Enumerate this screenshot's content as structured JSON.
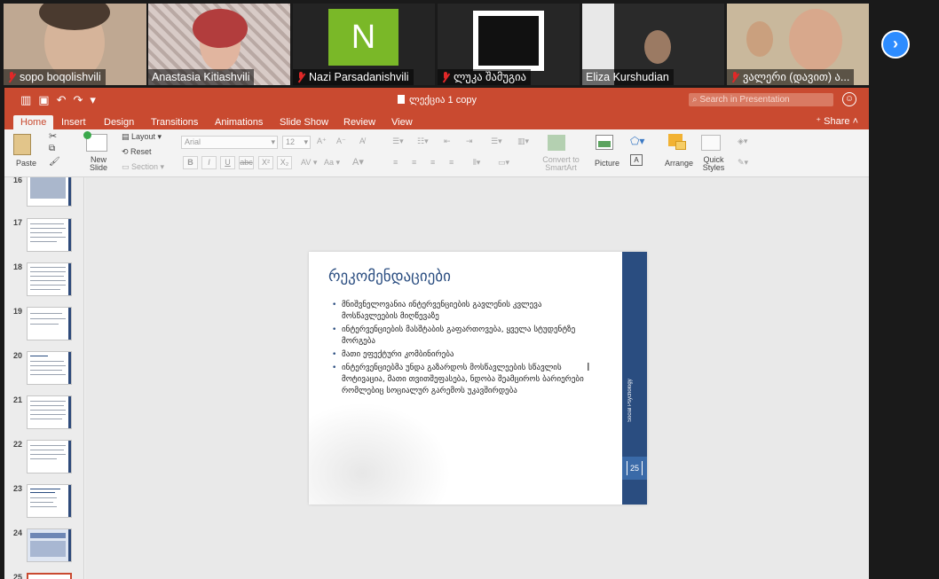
{
  "gallery": {
    "participants": [
      {
        "name": "sopo boqolishvili",
        "muted": true
      },
      {
        "name": "Anastasia Kitiashvili",
        "muted": false,
        "active": true
      },
      {
        "name": "Nazi Parsadanishvili",
        "muted": true,
        "initial": "N"
      },
      {
        "name": "ლუკა შამუგია",
        "muted": true
      },
      {
        "name": "Eliza Kurshudian",
        "muted": false
      },
      {
        "name": "ვალერი (დავით) ა...",
        "muted": true
      }
    ]
  },
  "window": {
    "doc_title": "ლექცია 1 copy",
    "search_placeholder": "Search in Presentation"
  },
  "tabs": [
    "Home",
    "Insert",
    "Design",
    "Transitions",
    "Animations",
    "Slide Show",
    "Review",
    "View"
  ],
  "share_label": "Share",
  "ribbon": {
    "paste": "Paste",
    "new_slide": "New Slide",
    "layout": "Layout",
    "reset": "Reset",
    "section": "Section",
    "font": "Arial",
    "size": "12",
    "convert": "Convert to SmartArt",
    "picture": "Picture",
    "arrange": "Arrange",
    "quick_styles": "Quick Styles"
  },
  "thumbnails": [
    {
      "num": "16"
    },
    {
      "num": "17"
    },
    {
      "num": "18"
    },
    {
      "num": "19"
    },
    {
      "num": "20"
    },
    {
      "num": "21"
    },
    {
      "num": "22"
    },
    {
      "num": "23"
    },
    {
      "num": "24"
    },
    {
      "num": "25"
    }
  ],
  "slide": {
    "title": "რეკომენდაციები",
    "bullets": [
      "მნიშვნელოვანია ინტერვენციების გავლენის კვლევა მოსწავლეების მიღწევაზე",
      "ინტერვენციების მასშტაბის გაფართოვება, ყველა სტუდენტზე მორგება",
      "მათი ეფექტური კომბინირება",
      "ინტერვენციებმა უნდა გაზარდოს მოსწავლეების სწავლის მოტივაცია, მათი თვითშეფასება, ნდობა შეამციროს ბარიერები რომლებიც სოციალურ გარემოს უკავშირდება"
    ],
    "side_label": "Social Psychology",
    "page_number": "25"
  }
}
